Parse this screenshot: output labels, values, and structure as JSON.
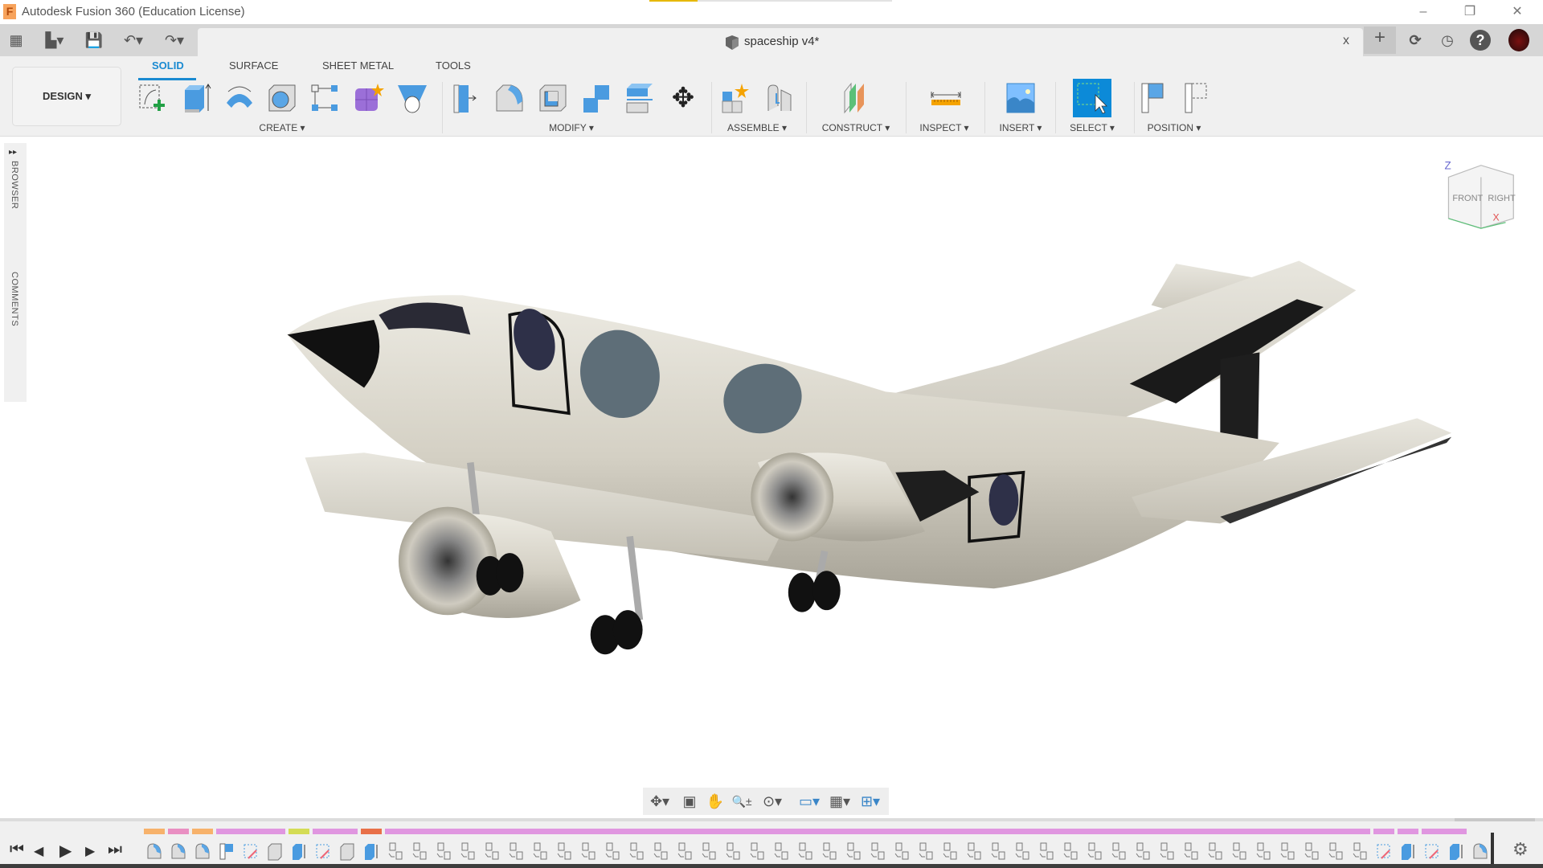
{
  "window": {
    "title": "Autodesk Fusion 360 (Education License)",
    "minimize": "–",
    "restore": "❐",
    "close": "✕"
  },
  "document": {
    "name": "spaceship v4*",
    "close": "x"
  },
  "quick_access": {
    "grid": "▦",
    "file": "▙▾",
    "save": "💾",
    "undo": "↶▾",
    "redo": "↷▾"
  },
  "top_right": {
    "new_tab": "+",
    "jobs": "⟳",
    "clock": "◷",
    "help": "?"
  },
  "ribbon": {
    "workspace": "DESIGN ▾",
    "tabs": [
      {
        "label": "SOLID",
        "active": true
      },
      {
        "label": "SURFACE"
      },
      {
        "label": "SHEET METAL"
      },
      {
        "label": "TOOLS"
      }
    ],
    "groups": [
      {
        "label": "CREATE ▾",
        "tools": [
          "create-sketch",
          "extrude",
          "revolve",
          "hole",
          "pattern",
          "create-form",
          "loft"
        ]
      },
      {
        "label": "MODIFY ▾",
        "tools": [
          "press-pull",
          "fillet",
          "shell",
          "combine",
          "offset-face",
          "move"
        ]
      },
      {
        "label": "ASSEMBLE ▾",
        "tools": [
          "new-component",
          "joint"
        ]
      },
      {
        "label": "CONSTRUCT ▾",
        "tools": [
          "offset-plane"
        ]
      },
      {
        "label": "INSPECT ▾",
        "tools": [
          "measure"
        ]
      },
      {
        "label": "INSERT ▾",
        "tools": [
          "insert-image"
        ]
      },
      {
        "label": "SELECT ▾",
        "tools": [
          "select"
        ]
      },
      {
        "label": "POSITION ▾",
        "tools": [
          "capture-position",
          "revert-position"
        ]
      }
    ]
  },
  "sidebar": {
    "browser": "BROWSER",
    "comments": "COMMENTS",
    "expand": "▸▸"
  },
  "viewcube": {
    "front": "FRONT",
    "right": "RIGHT",
    "z": "Z",
    "x": "X"
  },
  "navbar": {
    "orbit": "✥▾",
    "look": "▣",
    "pan": "✋",
    "zoom": "🔍±",
    "fit": "⊙▾",
    "display": "▭▾",
    "grid": "▦▾",
    "viewports": "⊞▾"
  },
  "playback": {
    "first": "⏮",
    "prev": "◀",
    "play": "▶",
    "next": "▶",
    "last": "⏭"
  },
  "timeline": {
    "colors": {
      "orange": "#f7b26b",
      "pink": "#e98fc2",
      "magenta": "#e096e0",
      "yellow": "#d4dc55",
      "red": "#e87048"
    },
    "bars": [
      {
        "color": "orange",
        "from": 0,
        "to": 0
      },
      {
        "color": "pink",
        "from": 1,
        "to": 1
      },
      {
        "color": "orange",
        "from": 2,
        "to": 2
      },
      {
        "color": "magenta",
        "from": 3,
        "to": 5
      },
      {
        "color": "yellow",
        "from": 6,
        "to": 6
      },
      {
        "color": "magenta",
        "from": 7,
        "to": 8
      },
      {
        "color": "red",
        "from": 9,
        "to": 9
      },
      {
        "color": "magenta",
        "from": 10,
        "to": 50
      },
      {
        "color": "magenta",
        "from": 51,
        "to": 51
      },
      {
        "color": "magenta",
        "from": 52,
        "to": 52
      },
      {
        "color": "magenta",
        "from": 53,
        "to": 54
      }
    ],
    "features": [
      "revolve",
      "revolve",
      "revolve",
      "split",
      "sketch",
      "fillet",
      "extrude",
      "sketch",
      "fillet",
      "extrude",
      "move",
      "move",
      "move",
      "move",
      "move",
      "move",
      "move",
      "move",
      "move",
      "move",
      "move",
      "move",
      "move",
      "move",
      "move",
      "move",
      "move",
      "move",
      "move",
      "move",
      "move",
      "move",
      "move",
      "move",
      "move",
      "move",
      "move",
      "move",
      "move",
      "move",
      "move",
      "move",
      "move",
      "move",
      "move",
      "move",
      "move",
      "move",
      "move",
      "move",
      "move",
      "sketch",
      "extrude",
      "sketch",
      "extrude",
      "revolve"
    ],
    "settings": "⚙"
  }
}
